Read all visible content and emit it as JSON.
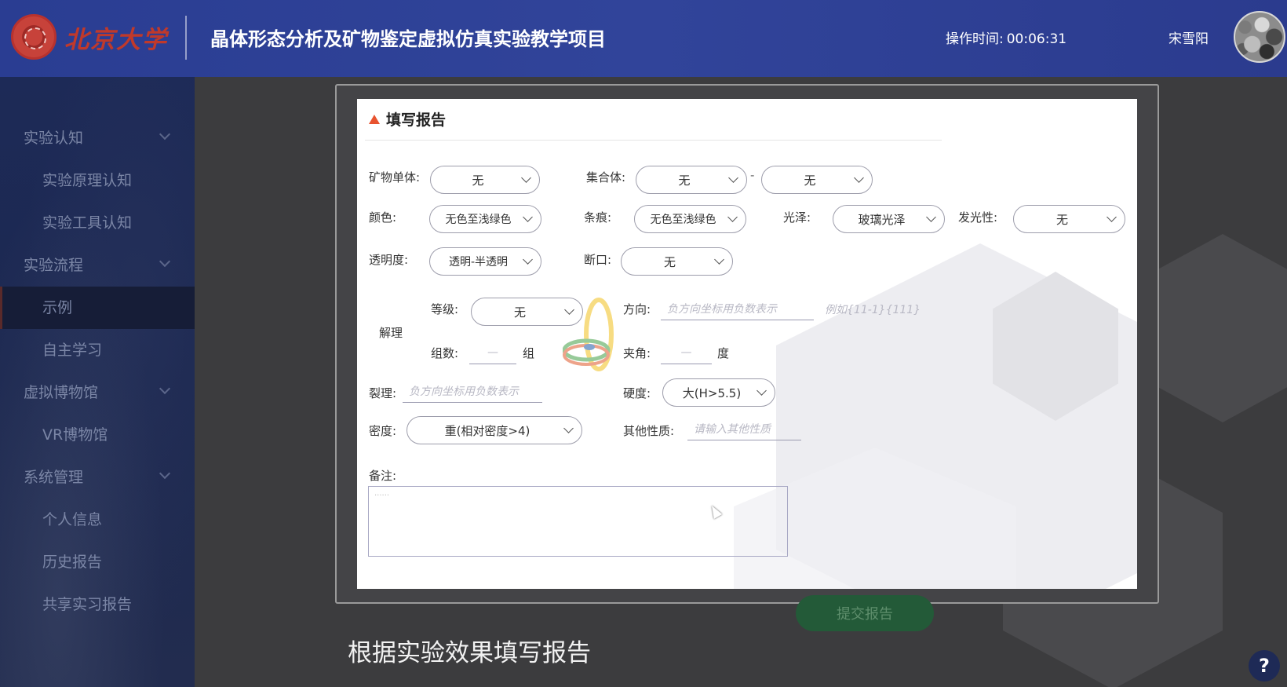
{
  "header": {
    "logo_text": "北京大学",
    "title": "晶体形态分析及矿物鉴定虚拟仿真实验教学项目",
    "op_time_label": "操作时间:",
    "op_time_value": "00:06:31",
    "user_name": "宋雪阳"
  },
  "sidebar": {
    "items": [
      {
        "label": "实验认知",
        "type": "group"
      },
      {
        "label": "实验原理认知",
        "type": "item"
      },
      {
        "label": "实验工具认知",
        "type": "item"
      },
      {
        "label": "实验流程",
        "type": "group"
      },
      {
        "label": "示例",
        "type": "item",
        "active": true
      },
      {
        "label": "自主学习",
        "type": "item"
      },
      {
        "label": "虚拟博物馆",
        "type": "group"
      },
      {
        "label": "VR博物馆",
        "type": "item"
      },
      {
        "label": "系统管理",
        "type": "group"
      },
      {
        "label": "个人信息",
        "type": "item"
      },
      {
        "label": "历史报告",
        "type": "item"
      },
      {
        "label": "共享实习报告",
        "type": "item"
      }
    ]
  },
  "report": {
    "title": "填写报告",
    "mineral_single": {
      "label": "矿物单体:",
      "value": "无"
    },
    "aggregate": {
      "label": "集合体:",
      "value1": "无",
      "sep": "-",
      "value2": "无"
    },
    "color": {
      "label": "颜色:",
      "value": "无色至浅绿色"
    },
    "streak": {
      "label": "条痕:",
      "value": "无色至浅绿色"
    },
    "luster": {
      "label": "光泽:",
      "value": "玻璃光泽"
    },
    "luminescence": {
      "label": "发光性:",
      "value": "无"
    },
    "transparency": {
      "label": "透明度:",
      "value": "透明-半透明"
    },
    "fracture": {
      "label": "断口:",
      "value": "无"
    },
    "cleavage": {
      "label": "解理",
      "grade_label": "等级:",
      "grade_value": "无",
      "direction_label": "方向:",
      "direction_placeholder": "负方向坐标用负数表示",
      "direction_hint": "例如{11-1}{111}",
      "groups_label": "组数:",
      "groups_value": "—",
      "groups_unit": "组",
      "angle_label": "夹角:",
      "angle_value": "—",
      "angle_unit": "度"
    },
    "parting": {
      "label": "裂理:",
      "placeholder": "负方向坐标用负数表示"
    },
    "hardness": {
      "label": "硬度:",
      "value": "大(H>5.5)"
    },
    "density": {
      "label": "密度:",
      "value": "重(相对密度>4)"
    },
    "other": {
      "label": "其他性质:",
      "placeholder": "请输入其他性质"
    },
    "remark": {
      "label": "备注:",
      "placeholder": "......"
    }
  },
  "submit_label": "提交报告",
  "caption": "根据实验效果填写报告",
  "help_label": "?",
  "colors": {
    "header": "#2a3d92",
    "sidebar": "#1d2a57",
    "accent": "#e8532f",
    "submit": "#235a38"
  }
}
